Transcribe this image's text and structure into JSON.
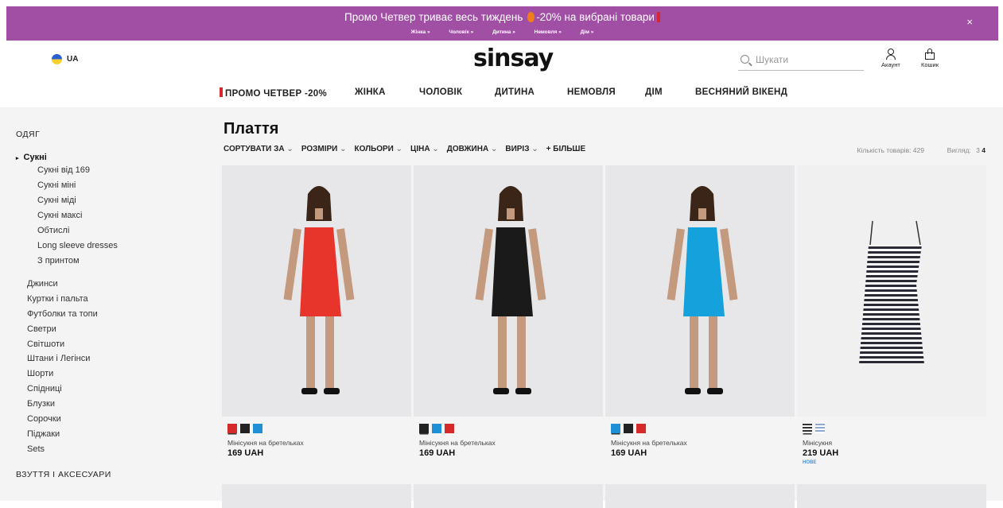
{
  "promo": {
    "text_before": "Промо Четвер триває весь тиждень",
    "text_after": "-20% на вибрані товари",
    "links": [
      "Жінка »",
      "Чоловік »",
      "Дитина »",
      "Немовля »",
      "Дім »"
    ],
    "close": "×"
  },
  "header": {
    "lang": "UA",
    "logo": "sinsay",
    "search_placeholder": "Шукати",
    "account": "Акаунт",
    "cart": "Кошик"
  },
  "nav": [
    "ПРОМО ЧЕТВЕР -20%",
    "ЖІНКА",
    "ЧОЛОВІК",
    "ДИТИНА",
    "НЕМОВЛЯ",
    "ДІМ",
    "ВЕСНЯНИЙ ВІКЕНД"
  ],
  "sidebar": {
    "category": "ОДЯГ",
    "selected": "Сукні",
    "subitems": [
      "Сукні від 169",
      "Сукні міні",
      "Сукні міді",
      "Сукні максі",
      "Обтислі",
      "Long sleeve dresses",
      "З принтом"
    ],
    "items": [
      "Джинси",
      "Куртки і пальта",
      "Футболки та топи",
      "Светри",
      "Світшоти",
      "Штани і Легінси",
      "Шорти",
      "Спідниці",
      "Блузки",
      "Сорочки",
      "Піджаки",
      "Sets"
    ],
    "category2": "ВЗУТТЯ І АКСЕСУАРИ"
  },
  "page": {
    "title": "Плаття",
    "filters": [
      "СОРТУВАТИ ЗА",
      "РОЗМІРИ",
      "КОЛЬОРИ",
      "ЦІНА",
      "ДОВЖИНА",
      "ВИРІЗ"
    ],
    "more": "+ БІЛЬШЕ",
    "count": "Кількість товарів: 429",
    "view_label": "Вигляд:",
    "view_3": "3",
    "view_4": "4"
  },
  "products": [
    {
      "name": "Мінісукня на бретельках",
      "price": "169 UAH",
      "badge": "",
      "dress_color": "#e8352c",
      "swatches": [
        "#d42a2a",
        "#222222",
        "#1f8fd6"
      ]
    },
    {
      "name": "Мінісукня на бретельках",
      "price": "169 UAH",
      "badge": "",
      "dress_color": "#1a1a1a",
      "swatches": [
        "#222222",
        "#1f8fd6",
        "#d42a2a"
      ]
    },
    {
      "name": "Мінісукня на бретельках",
      "price": "169 UAH",
      "badge": "",
      "dress_color": "#15a2dc",
      "swatches": [
        "#1f8fd6",
        "#222222",
        "#d42a2a"
      ]
    },
    {
      "name": "Мінісукня",
      "price": "219 UAH",
      "badge": "НОВЕ",
      "dress_color": "stripes",
      "swatches": [
        "stripes-dark",
        "stripes-light"
      ]
    }
  ],
  "colors": {
    "promo_bg": "#a04fa5",
    "content_bg": "#f4f4f5",
    "accent_red": "#d8262f",
    "badge_blue": "#4a90d9"
  }
}
